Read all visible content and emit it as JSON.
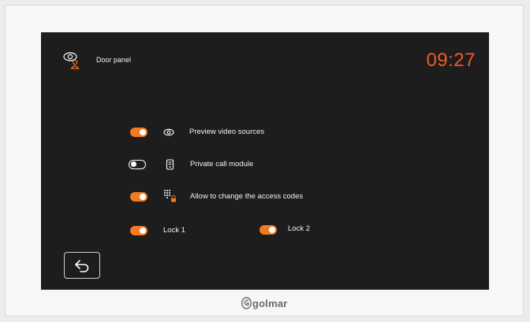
{
  "header": {
    "title": "Door panel",
    "time": "09:27",
    "icon": "eye-person-icon"
  },
  "settings": {
    "preview": {
      "label": "Preview video sources",
      "enabled": true,
      "icon": "eye-icon"
    },
    "private_call": {
      "label": "Private call module",
      "enabled": false,
      "icon": "intercom-icon"
    },
    "access_codes": {
      "label": "Allow to change the access codes",
      "enabled": true,
      "icon": "keypad-lock-icon"
    },
    "lock1": {
      "label": "Lock 1",
      "enabled": true
    },
    "lock2": {
      "label": "Lock 2",
      "enabled": true
    }
  },
  "footer": {
    "back_icon": "back-arrow-icon",
    "brand": "golmar"
  },
  "colors": {
    "accent": "#f47a20",
    "clock": "#f05a24",
    "screen_bg": "#1d1d1d"
  }
}
